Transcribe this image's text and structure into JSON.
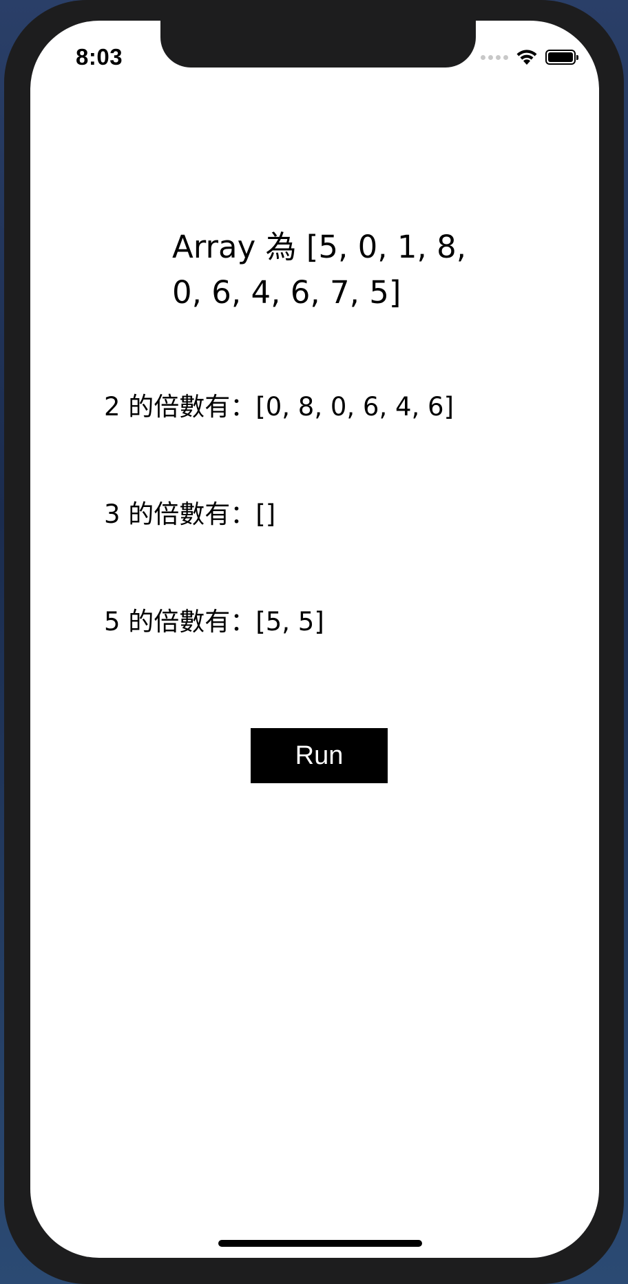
{
  "status_bar": {
    "time": "8:03",
    "icons": [
      "cellular-signal-icon",
      "wifi-icon",
      "battery-icon"
    ]
  },
  "main": {
    "array_label": "Array 為 [5, 0, 1, 8, 0, 6, 4, 6, 7, 5]",
    "results": [
      {
        "label": "2 的倍數有：[0, 8, 0, 6, 4, 6]"
      },
      {
        "label": "3 的倍數有：[]"
      },
      {
        "label": "5 的倍數有：[5, 5]"
      }
    ],
    "run_button_label": "Run"
  },
  "colors": {
    "device_frame": "#1d1d1e",
    "screen_background": "#ffffff",
    "button_background": "#000000",
    "button_text": "#ffffff"
  }
}
